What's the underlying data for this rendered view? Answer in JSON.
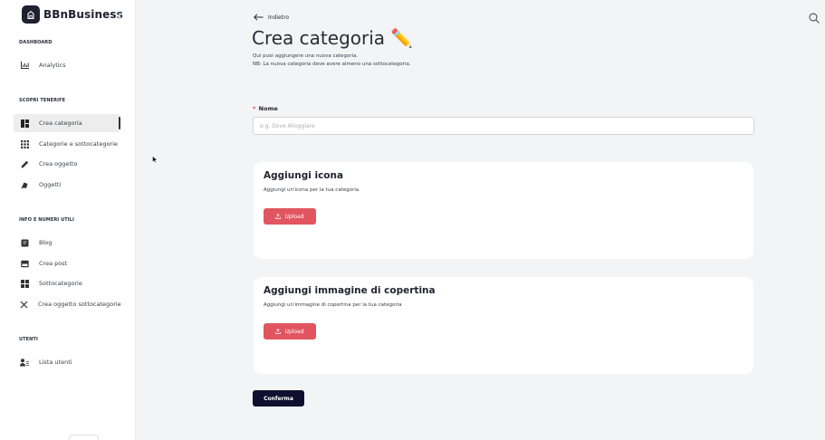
{
  "brand": {
    "name": "BBnBusiness"
  },
  "sidebar": {
    "sections": [
      {
        "title": "DASHBOARD",
        "items": [
          {
            "label": "Analytics",
            "icon": "chart-icon"
          }
        ]
      },
      {
        "title": "SCOPRI TENERIFE",
        "items": [
          {
            "label": "Crea categoria",
            "icon": "dashboard-icon",
            "active": true
          },
          {
            "label": "Categorie e sottocategorie",
            "icon": "grid-icon"
          },
          {
            "label": "Crea oggetto",
            "icon": "pencil-icon"
          },
          {
            "label": "Oggetti",
            "icon": "objects-icon"
          }
        ]
      },
      {
        "title": "INFO E NUMERI UTILI",
        "items": [
          {
            "label": "Blog",
            "icon": "book-icon"
          },
          {
            "label": "Crea post",
            "icon": "post-icon"
          },
          {
            "label": "Sottocategorie",
            "icon": "tiles-icon"
          },
          {
            "label": "Crea oggetto sottocategorie",
            "icon": "tools-icon"
          }
        ]
      },
      {
        "title": "UTENTI",
        "items": [
          {
            "label": "Lista utenti",
            "icon": "user-list-icon"
          }
        ]
      }
    ]
  },
  "main": {
    "back_label": "Indietro",
    "title": "Crea categoria ✏️",
    "description_1": "Qui puoi aggiungere una nuova categoria.",
    "description_2": "NB: La nuova categoria deve avere almeno una sottocategoria.",
    "name_field": {
      "required_mark": "*",
      "label": "Nome",
      "placeholder": "e.g. Dove Alloggiare",
      "value": ""
    },
    "icon_card": {
      "title": "Aggiungi icona",
      "subtitle": "Aggiungi un'icona per la tua categoria",
      "button_label": "Upload"
    },
    "cover_card": {
      "title": "Aggiungi immagine di copertina",
      "subtitle": "Aggiungi un'immagine di copertina per la tua categoria",
      "button_label": "Upload"
    },
    "confirm_label": "Conferma"
  },
  "colors": {
    "upload_button": "#e15560",
    "confirm_button": "#0f1030",
    "required": "#e0434c",
    "active_nav": "#ededed"
  }
}
